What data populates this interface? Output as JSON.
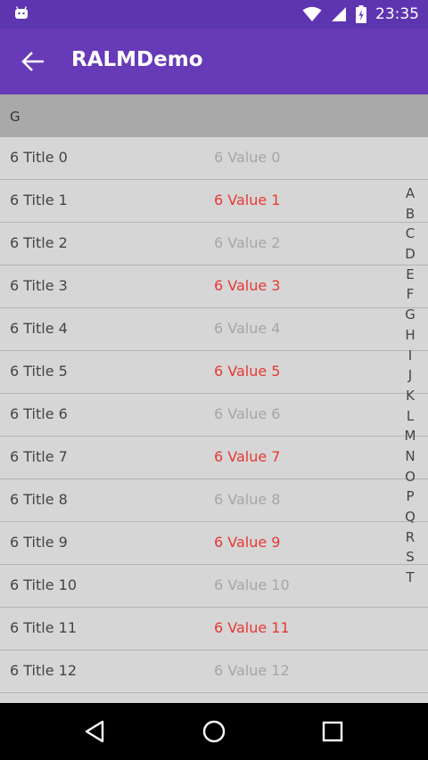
{
  "status_bar": {
    "time": "23:35"
  },
  "toolbar": {
    "title": "RALMDemo"
  },
  "section": {
    "header": "G"
  },
  "rows": [
    {
      "title": "6 Title 0",
      "value": "6 Value 0"
    },
    {
      "title": "6 Title 1",
      "value": "6 Value 1"
    },
    {
      "title": "6 Title 2",
      "value": "6 Value 2"
    },
    {
      "title": "6 Title 3",
      "value": "6 Value 3"
    },
    {
      "title": "6 Title 4",
      "value": "6 Value 4"
    },
    {
      "title": "6 Title 5",
      "value": "6 Value 5"
    },
    {
      "title": "6 Title 6",
      "value": "6 Value 6"
    },
    {
      "title": "6 Title 7",
      "value": "6 Value 7"
    },
    {
      "title": "6 Title 8",
      "value": "6 Value 8"
    },
    {
      "title": "6 Title 9",
      "value": "6 Value 9"
    },
    {
      "title": "6 Title 10",
      "value": "6 Value 10"
    },
    {
      "title": "6 Title 11",
      "value": "6 Value 11"
    },
    {
      "title": "6 Title 12",
      "value": "6 Value 12"
    }
  ],
  "index_letters": [
    "A",
    "B",
    "C",
    "D",
    "E",
    "F",
    "G",
    "H",
    "I",
    "J",
    "K",
    "L",
    "M",
    "N",
    "O",
    "P",
    "Q",
    "R",
    "S",
    "T"
  ],
  "colors": {
    "status_bar": "#5e35b1",
    "toolbar": "#673ab7",
    "list_bg": "#d6d6d6",
    "section_header_bg": "#a9a9a9",
    "value_muted": "#a6a6a6",
    "value_accent": "#e53935"
  },
  "icons": {
    "status_left": "android-notification-icon",
    "status_right": [
      "wifi-icon",
      "signal-icon",
      "battery-icon"
    ],
    "toolbar_nav": "back-arrow-icon",
    "nav_bar": [
      "nav-back-icon",
      "nav-home-icon",
      "nav-recents-icon"
    ]
  }
}
